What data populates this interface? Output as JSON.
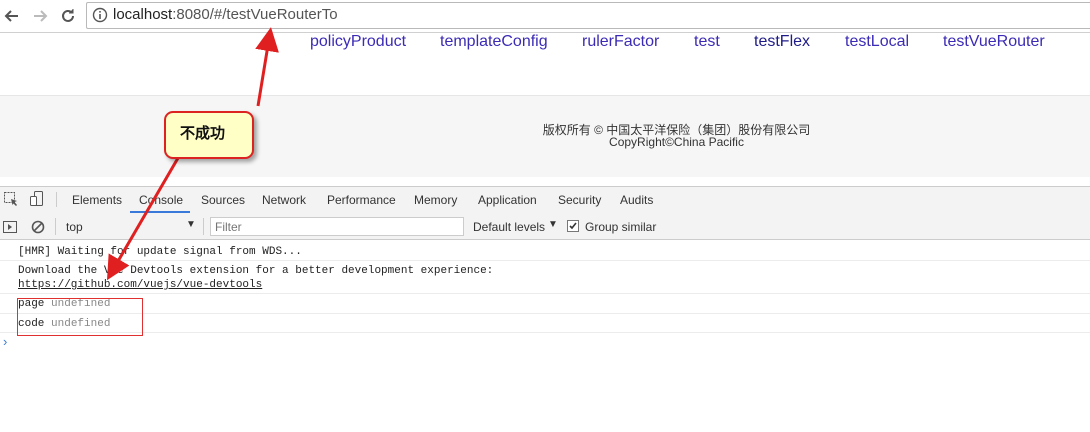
{
  "browser": {
    "url_host": "localhost",
    "url_rest": ":8080/#/testVueRouterTo"
  },
  "page": {
    "nav": [
      "policyProduct",
      "templateConfig",
      "rulerFactor",
      "test",
      "testFlex",
      "testLocal",
      "testVueRouter"
    ],
    "footer_line1": "版权所有 © 中国太平洋保险（集团）股份有限公司",
    "footer_line2": "CopyRight©China Pacific"
  },
  "devtools": {
    "tabs": [
      "Elements",
      "Console",
      "Sources",
      "Network",
      "Performance",
      "Memory",
      "Application",
      "Security",
      "Audits"
    ],
    "active_tab": "Console",
    "context": "top",
    "filter_placeholder": "Filter",
    "levels": "Default levels",
    "group_similar": "Group similar",
    "logs": {
      "hmr": "[HMR] Waiting for update signal from WDS...",
      "devtools": "Download the Vue Devtools extension for a better development experience:",
      "devtools_link": "https://github.com/vuejs/vue-devtools",
      "page_key": "page",
      "page_val": "undefined",
      "code_key": "code",
      "code_val": "undefined"
    }
  },
  "annotation": {
    "callout_text": "不成功",
    "color": "#e02020"
  }
}
